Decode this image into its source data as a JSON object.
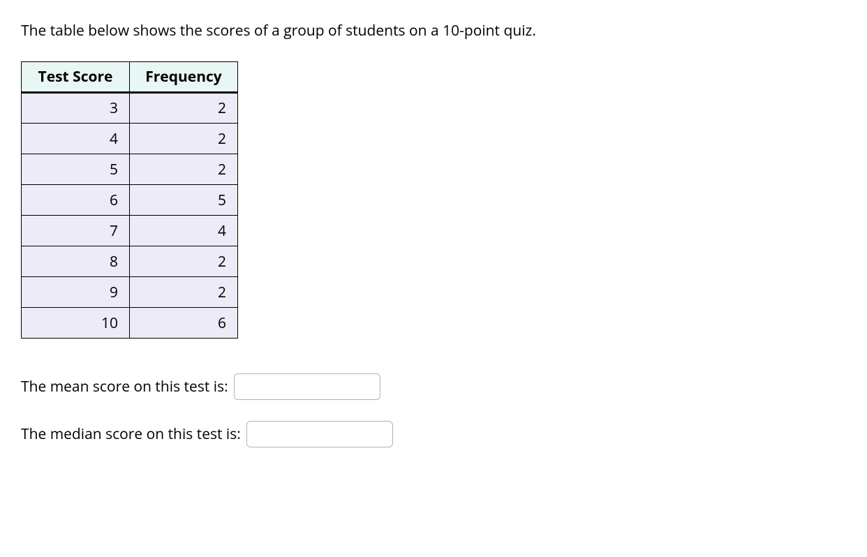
{
  "intro_text": "The table below shows the scores of a group of students on a 10-point quiz.",
  "table": {
    "headers": [
      "Test Score",
      "Frequency"
    ],
    "rows": [
      {
        "score": "3",
        "freq": "2"
      },
      {
        "score": "4",
        "freq": "2"
      },
      {
        "score": "5",
        "freq": "2"
      },
      {
        "score": "6",
        "freq": "5"
      },
      {
        "score": "7",
        "freq": "4"
      },
      {
        "score": "8",
        "freq": "2"
      },
      {
        "score": "9",
        "freq": "2"
      },
      {
        "score": "10",
        "freq": "6"
      }
    ]
  },
  "questions": {
    "mean": {
      "label": "The mean score on this test is:",
      "value": ""
    },
    "median": {
      "label": "The median score on this test is:",
      "value": ""
    }
  }
}
